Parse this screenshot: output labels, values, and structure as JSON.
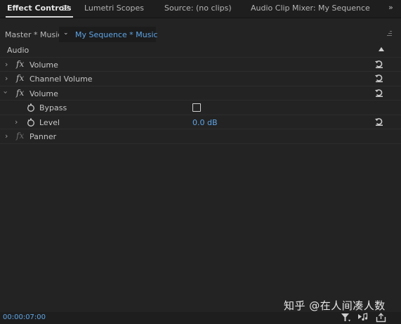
{
  "tabs": [
    {
      "label": "Effect Controls",
      "active": true
    },
    {
      "label": "Lumetri Scopes",
      "active": false
    },
    {
      "label": "Source: (no clips)",
      "active": false
    },
    {
      "label": "Audio Clip Mixer: My Sequence",
      "active": false
    }
  ],
  "subheader": {
    "master_label": "Master * Music",
    "sequence_label": "My Sequence * Music"
  },
  "section": {
    "label": "Audio"
  },
  "effects": {
    "volume_1": "Volume",
    "channel_volume": "Channel Volume",
    "volume_2": "Volume",
    "bypass": "Bypass",
    "level": "Level",
    "level_value": "0.0 dB",
    "panner": "Panner"
  },
  "footer": {
    "timecode": "00:00:07:00"
  },
  "watermark": "知乎 @在人间凑人数",
  "colors": {
    "accent_blue": "#5ea5e6",
    "panel_bg": "#232323",
    "tabbar_bg": "#1e1e1e"
  }
}
